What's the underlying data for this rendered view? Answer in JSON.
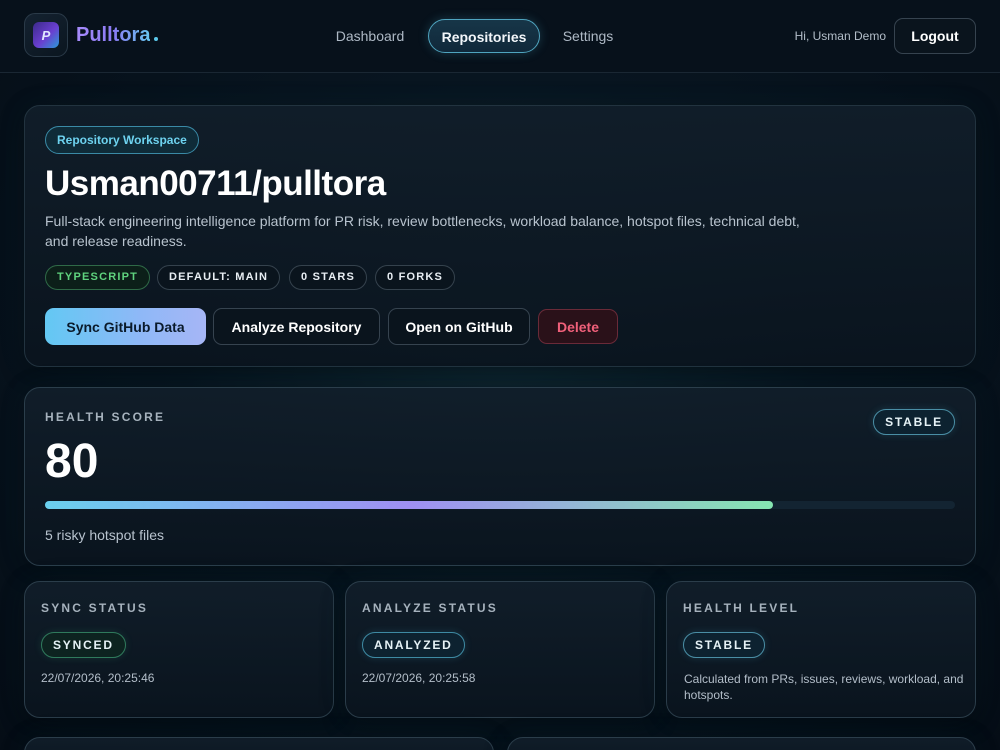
{
  "header": {
    "logo_text": "Pulltora",
    "brand": "Pulltora",
    "nav": {
      "dashboard": "Dashboard",
      "repositories": "Repositories",
      "settings": "Settings"
    },
    "greeting": "Hi, Usman Demo",
    "logout": "Logout"
  },
  "repo": {
    "workspace_label": "Repository Workspace",
    "title": "Usman00711/pulltora",
    "description": "Full-stack engineering intelligence platform for PR risk, review bottlenecks, workload balance, hotspot files, technical debt, and release readiness.",
    "tags": {
      "language": "TYPESCRIPT",
      "default_branch": "DEFAULT: MAIN",
      "stars": "0 STARS",
      "forks": "0 FORKS"
    },
    "actions": {
      "sync": "Sync GitHub Data",
      "analyze": "Analyze Repository",
      "open": "Open on GitHub",
      "delete": "Delete"
    }
  },
  "health": {
    "label": "HEALTH SCORE",
    "score": "80",
    "progress_percent": 80,
    "status": "STABLE",
    "hotspots": "5 risky hotspot files"
  },
  "stats": {
    "sync": {
      "label": "SYNC STATUS",
      "status": "SYNCED",
      "timestamp": "22/07/2026, 20:25:46"
    },
    "analyze": {
      "label": "ANALYZE STATUS",
      "status": "ANALYZED",
      "timestamp": "22/07/2026, 20:25:58"
    },
    "health_level": {
      "label": "HEALTH LEVEL",
      "status": "STABLE",
      "note": "Calculated from PRs, issues, reviews, workload, and hotspots."
    }
  },
  "colors": {
    "accent_cyan": "#63c8f3",
    "accent_purple": "#a78bfa",
    "success_green": "#5fd37e",
    "danger_red": "#f0607a"
  }
}
